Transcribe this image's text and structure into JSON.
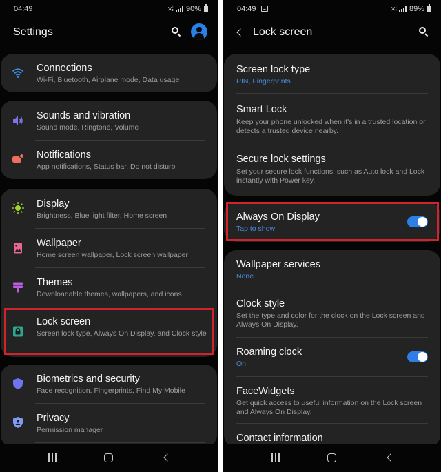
{
  "left_screen": {
    "status": {
      "time": "04:49",
      "battery": "90%"
    },
    "title": "Settings",
    "groups": [
      {
        "items": [
          {
            "title": "Connections",
            "subtitle": "Wi-Fi, Bluetooth, Airplane mode, Data usage",
            "icon": "wifi-icon",
            "icon_color": "#3d8ee6"
          }
        ]
      },
      {
        "items": [
          {
            "title": "Sounds and vibration",
            "subtitle": "Sound mode, Ringtone, Volume",
            "icon": "volume-icon",
            "icon_color": "#7b73e6"
          },
          {
            "title": "Notifications",
            "subtitle": "App notifications, Status bar, Do not disturb",
            "icon": "notifications-icon",
            "icon_color": "#ef6f5e"
          }
        ]
      },
      {
        "items": [
          {
            "title": "Display",
            "subtitle": "Brightness, Blue light filter, Home screen",
            "icon": "brightness-icon",
            "icon_color": "#9fd62b"
          },
          {
            "title": "Wallpaper",
            "subtitle": "Home screen wallpaper, Lock screen wallpaper",
            "icon": "wallpaper-icon",
            "icon_color": "#e8668f"
          },
          {
            "title": "Themes",
            "subtitle": "Downloadable themes, wallpapers, and icons",
            "icon": "themes-icon",
            "icon_color": "#b85fe0"
          },
          {
            "title": "Lock screen",
            "subtitle": "Screen lock type, Always On Display, and Clock style",
            "icon": "lock-icon",
            "icon_color": "#2ea68d"
          }
        ]
      },
      {
        "items": [
          {
            "title": "Biometrics and security",
            "subtitle": "Face recognition, Fingerprints, Find My Mobile",
            "icon": "shield-icon",
            "icon_color": "#6f73f0"
          },
          {
            "title": "Privacy",
            "subtitle": "Permission manager",
            "icon": "privacy-icon",
            "icon_color": "#6f93f0"
          }
        ]
      }
    ]
  },
  "right_screen": {
    "status": {
      "time": "04:49",
      "battery": "89%"
    },
    "title": "Lock screen",
    "groups": [
      {
        "items": [
          {
            "title": "Screen lock type",
            "subtitle": "PIN, Fingerprints",
            "subtitle_style": "accent"
          },
          {
            "title": "Smart Lock",
            "subtitle": "Keep your phone unlocked when it's in a trusted location or detects a trusted device nearby."
          },
          {
            "title": "Secure lock settings",
            "subtitle": "Set your secure lock functions, such as Auto lock and Lock instantly with Power key."
          }
        ]
      },
      {
        "items": [
          {
            "title": "Always On Display",
            "subtitle": "Tap to show",
            "subtitle_style": "accent",
            "toggle": true
          }
        ]
      },
      {
        "items": [
          {
            "title": "Wallpaper services",
            "subtitle": "None",
            "subtitle_style": "accent"
          },
          {
            "title": "Clock style",
            "subtitle": "Set the type and color for the clock on the Lock screen and Always On Display."
          },
          {
            "title": "Roaming clock",
            "subtitle": "On",
            "subtitle_style": "accent",
            "toggle": true
          },
          {
            "title": "FaceWidgets",
            "subtitle": "Get quick access to useful information on the Lock screen and Always On Display."
          },
          {
            "title": "Contact information",
            "subtitle": ""
          }
        ]
      }
    ]
  },
  "colors": {
    "accent": "#4b8cdf",
    "toggle_on": "#2d7ee6",
    "highlight": "#d0242c",
    "card": "#232323",
    "background": "#050505"
  }
}
